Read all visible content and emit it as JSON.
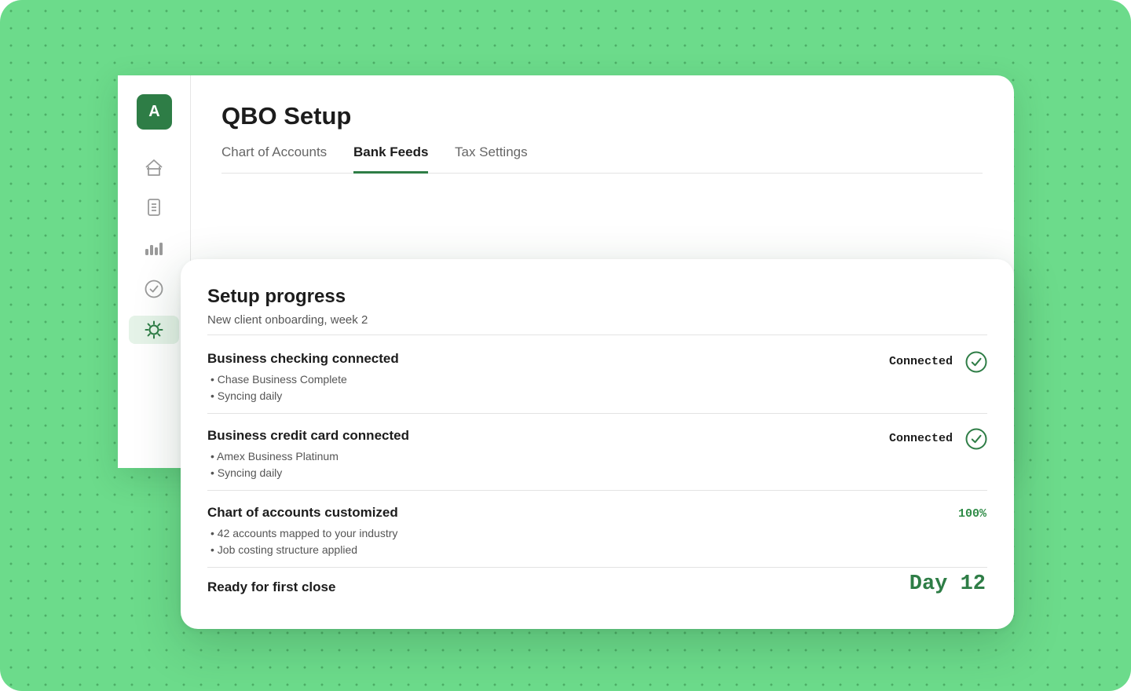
{
  "app": {
    "avatar_initial": "A",
    "page_title": "QBO Setup",
    "accent_color": "#2e7d46",
    "background_color": "#6cdb8b"
  },
  "sidebar": {
    "items": [
      {
        "icon": "home-icon"
      },
      {
        "icon": "document-icon"
      },
      {
        "icon": "bar-chart-icon"
      },
      {
        "icon": "check-circle-icon"
      },
      {
        "icon": "gear-icon",
        "active": true
      }
    ]
  },
  "tabs": [
    {
      "label": "Chart of Accounts"
    },
    {
      "label": "Bank Feeds",
      "active": true
    },
    {
      "label": "Tax Settings"
    }
  ],
  "progress": {
    "title": "Setup progress",
    "subtitle": "New client onboarding, week 2",
    "items": [
      {
        "title": "Business checking connected",
        "details": [
          "Chase Business Complete",
          "Syncing daily"
        ],
        "status": "Connected"
      },
      {
        "title": "Business credit card connected",
        "details": [
          "Amex Business Platinum",
          "Syncing daily"
        ],
        "status": "Connected"
      },
      {
        "title": "Chart of accounts customized",
        "details": [
          "42 accounts mapped to your industry",
          "Job costing structure applied"
        ],
        "percent": "100%"
      }
    ],
    "footer": {
      "label": "Ready for first close",
      "value": "Day 12"
    }
  }
}
